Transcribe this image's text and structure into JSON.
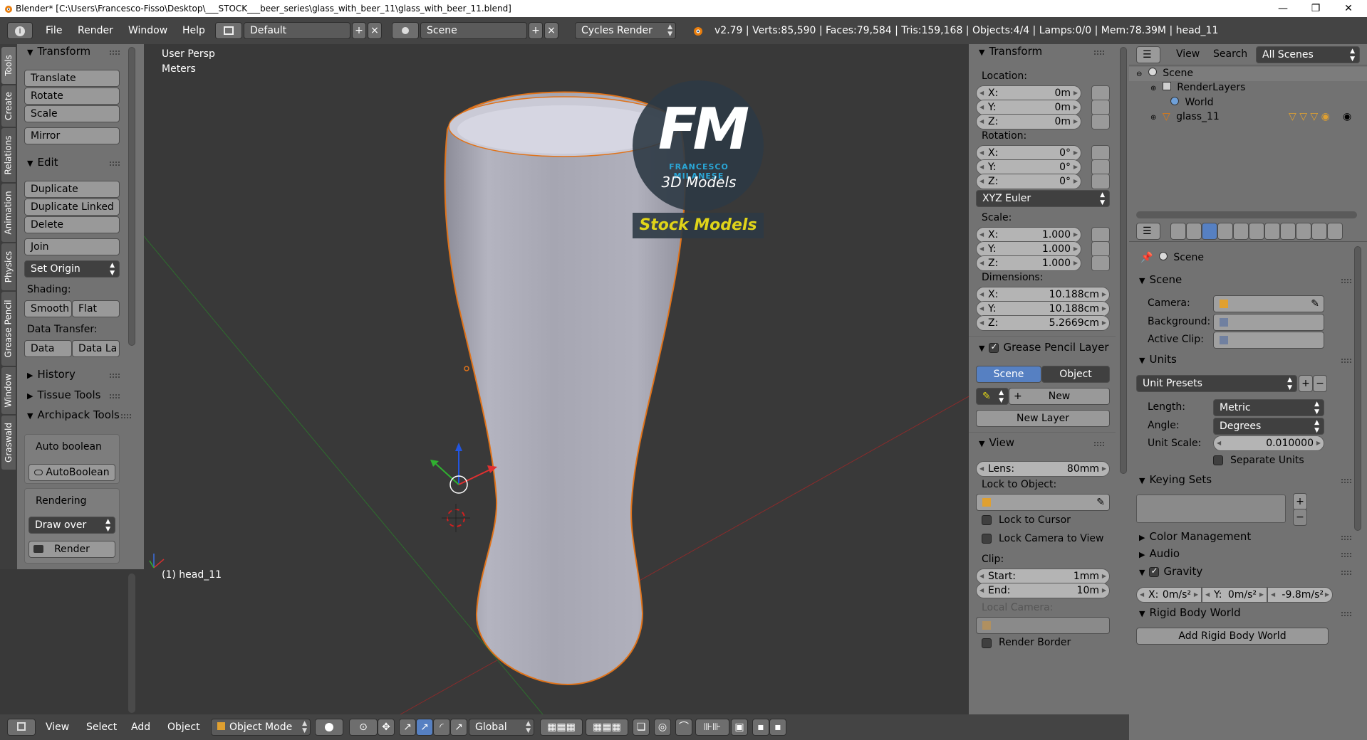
{
  "window": {
    "title": "Blender* [C:\\Users\\Francesco-Fisso\\Desktop\\___STOCK___beer_series\\glass_with_beer_11\\glass_with_beer_11.blend]",
    "minimize": "—",
    "maximize": "❐",
    "close": "✕"
  },
  "header": {
    "menus": [
      "File",
      "Render",
      "Window",
      "Help"
    ],
    "layout": "Default",
    "scene": "Scene",
    "engine": "Cycles Render",
    "stats": "v2.79 | Verts:85,590 | Faces:79,584 | Tris:159,168 | Objects:4/4 | Lamps:0/0 | Mem:78.39M | head_11"
  },
  "tabs": [
    "Tools",
    "Create",
    "Relations",
    "Animation",
    "Physics",
    "Grease Pencil",
    "Window",
    "Graswald"
  ],
  "tools": {
    "transform_title": "Transform",
    "translate": "Translate",
    "rotate": "Rotate",
    "scale": "Scale",
    "mirror": "Mirror",
    "edit_title": "Edit",
    "duplicate": "Duplicate",
    "duplicate_linked": "Duplicate Linked",
    "delete": "Delete",
    "join": "Join",
    "set_origin": "Set Origin",
    "shading_label": "Shading:",
    "smooth": "Smooth",
    "flat": "Flat",
    "data_transfer_label": "Data Transfer:",
    "data": "Data",
    "data_la": "Data La",
    "history": "History",
    "tissue": "Tissue Tools",
    "archipack": "Archipack Tools",
    "auto_boolean_label": "Auto boolean",
    "autoboolean": "AutoBoolean",
    "rendering_label": "Rendering",
    "draw_over": "Draw over",
    "render": "Render"
  },
  "viewport": {
    "view_name": "User Persp",
    "units": "Meters",
    "object_label": "(1) head_11",
    "logo_letters": "FM",
    "logo_name": "FRANCESCO MILANESE",
    "logo_sub": "3D Models",
    "stock": "Stock Models",
    "bg_color": "#393939",
    "logo_blue": "#2aa6d6",
    "stock_color": "#e0d419"
  },
  "npanel": {
    "transform_title": "Transform",
    "location_label": "Location:",
    "location": [
      {
        "k": "X:",
        "v": "0m"
      },
      {
        "k": "Y:",
        "v": "0m"
      },
      {
        "k": "Z:",
        "v": "0m"
      }
    ],
    "rotation_label": "Rotation:",
    "rotation": [
      {
        "k": "X:",
        "v": "0°"
      },
      {
        "k": "Y:",
        "v": "0°"
      },
      {
        "k": "Z:",
        "v": "0°"
      }
    ],
    "rotation_mode": "XYZ Euler",
    "scale_label": "Scale:",
    "scale": [
      {
        "k": "X:",
        "v": "1.000"
      },
      {
        "k": "Y:",
        "v": "1.000"
      },
      {
        "k": "Z:",
        "v": "1.000"
      }
    ],
    "dimensions_label": "Dimensions:",
    "dimensions": [
      {
        "k": "X:",
        "v": "10.188cm"
      },
      {
        "k": "Y:",
        "v": "10.188cm"
      },
      {
        "k": "Z:",
        "v": "5.2669cm"
      }
    ],
    "grease_title": "Grease Pencil Layer",
    "gp_scene": "Scene",
    "gp_object": "Object",
    "gp_new": "New",
    "gp_new_layer": "New Layer",
    "view_title": "View",
    "lens_k": "Lens:",
    "lens_v": "80mm",
    "lock_object_label": "Lock to Object:",
    "lock_cursor": "Lock to Cursor",
    "lock_camera": "Lock Camera to View",
    "clip_label": "Clip:",
    "clip_start_k": "Start:",
    "clip_start_v": "1mm",
    "clip_end_k": "End:",
    "clip_end_v": "10m",
    "local_camera_label": "Local Camera:",
    "render_border": "Render Border"
  },
  "outliner": {
    "view": "View",
    "search": "Search",
    "filter": "All Scenes",
    "items": [
      "Scene",
      "RenderLayers",
      "World",
      "glass_11"
    ]
  },
  "properties": {
    "context": "Scene",
    "scene_title": "Scene",
    "camera_label": "Camera:",
    "background_label": "Background:",
    "active_clip_label": "Active Clip:",
    "units_title": "Units",
    "unit_presets": "Unit Presets",
    "length_label": "Length:",
    "length": "Metric",
    "angle_label": "Angle:",
    "angle": "Degrees",
    "unit_scale_label": "Unit Scale:",
    "unit_scale": "0.010000",
    "separate_units": "Separate Units",
    "keying_title": "Keying Sets",
    "color_mgmt": "Color Management",
    "audio": "Audio",
    "gravity": "Gravity",
    "gravity_x_k": "X:",
    "gravity_x_v": "0m/s²",
    "gravity_y_k": "Y:",
    "gravity_y_v": "0m/s²",
    "gravity_z_k": "Z:",
    "gravity_z_v": "-9.8m/s²",
    "rigid_body": "Rigid Body World",
    "add_rigid": "Add Rigid Body World"
  },
  "bottombar": {
    "view": "View",
    "select": "Select",
    "add": "Add",
    "object": "Object",
    "mode": "Object Mode",
    "orientation": "Global"
  }
}
